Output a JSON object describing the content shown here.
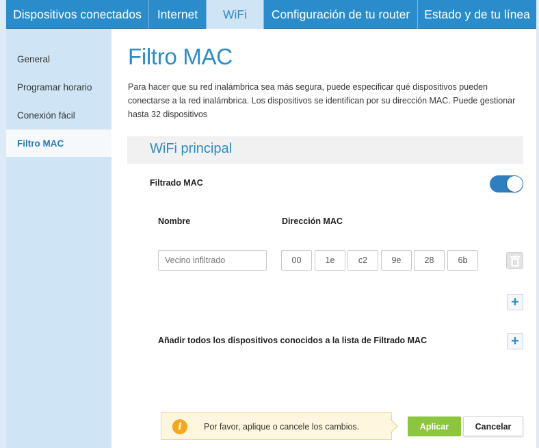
{
  "nav": {
    "tabs": [
      {
        "label": "Dispositivos conectados"
      },
      {
        "label": "Internet"
      },
      {
        "label": "WiFi"
      },
      {
        "label": "Configuración de tu router"
      },
      {
        "label": "Estado y de tu línea"
      }
    ],
    "active_tab": "WiFi"
  },
  "sidebar": {
    "items": [
      {
        "label": "General"
      },
      {
        "label": "Programar horario"
      },
      {
        "label": "Conexión fácil"
      },
      {
        "label": "Filtro MAC"
      }
    ],
    "active_item": "Filtro MAC"
  },
  "page": {
    "title": "Filtro MAC",
    "description": "Para hacer que su red inalámbrica sea más segura, puede especificar qué dispositivos pueden conectarse a la red inalámbrica. Los dispositivos se identifican por su dirección MAC. Puede gestionar hasta 32 dispositivos"
  },
  "section": {
    "title": "WiFi principal",
    "filter_label": "Filtrado MAC",
    "filter_enabled": true
  },
  "table": {
    "col_name": "Nombre",
    "col_mac": "Dirección MAC",
    "row": {
      "name_placeholder": "Vecino infiltrado",
      "mac": [
        "00",
        "1e",
        "c2",
        "9e",
        "28",
        "6b"
      ],
      "separator": "."
    }
  },
  "add_all_label": "Añadir todos los dispositivos conocidos a la lista de Filtrado MAC",
  "footer": {
    "notice_text": "Por favor, aplique o cancele los cambios.",
    "apply_label": "Aplicar",
    "cancel_label": "Cancelar"
  },
  "icons": {
    "info": "info-icon",
    "trash": "trash-icon",
    "plus": "plus-icon"
  },
  "colors": {
    "brand_blue": "#2a8ccb",
    "apply_green": "#8cc63e",
    "warning_orange": "#f4a81d"
  }
}
